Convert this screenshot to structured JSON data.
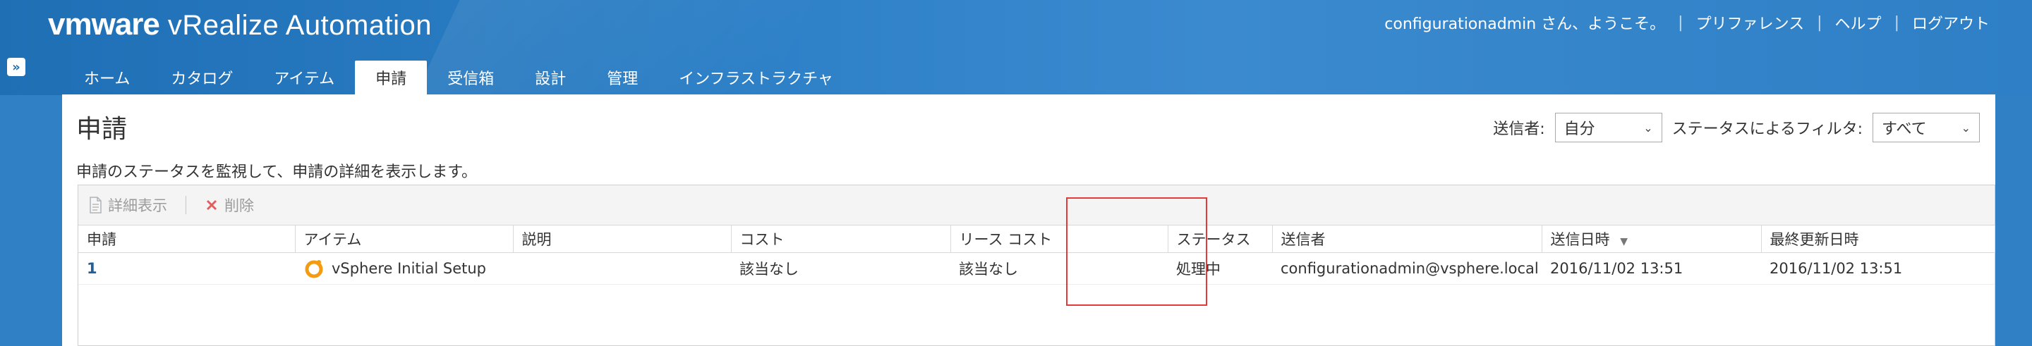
{
  "header": {
    "brand_vm": "vmware",
    "brand_product": "vRealize Automation",
    "user_greeting": "configurationadmin さん、ようこそ。",
    "links": {
      "preferences": "プリファレンス",
      "help": "ヘルプ",
      "logout": "ログアウト"
    },
    "tabs": [
      {
        "label": "ホーム"
      },
      {
        "label": "カタログ"
      },
      {
        "label": "アイテム"
      },
      {
        "label": "申請",
        "active": true
      },
      {
        "label": "受信箱"
      },
      {
        "label": "設計"
      },
      {
        "label": "管理"
      },
      {
        "label": "インフラストラクチャ"
      }
    ]
  },
  "page": {
    "title": "申請",
    "description": "申請のステータスを監視して、申請の詳細を表示します。",
    "filters": {
      "sender_label": "送信者:",
      "sender_value": "自分",
      "status_label": "ステータスによるフィルタ:",
      "status_value": "すべて"
    }
  },
  "toolbar": {
    "details_label": "詳細表示",
    "delete_label": "削除"
  },
  "table": {
    "columns": [
      "申請",
      "アイテム",
      "説明",
      "コスト",
      "リース コスト",
      "ステータス",
      "送信者",
      "送信日時",
      "最終更新日時"
    ],
    "rows": [
      {
        "request": "1",
        "item": "vSphere Initial Setup",
        "description": "",
        "cost": "該当なし",
        "lease_cost": "該当なし",
        "status": "処理中",
        "sender": "configurationadmin@vsphere.local",
        "submitted": "2016/11/02 13:51",
        "updated": "2016/11/02 13:51"
      }
    ]
  },
  "colors": {
    "header_blue": "#2c7fc6",
    "highlight": "#e23b3b",
    "item_icon": "#f39c12"
  }
}
